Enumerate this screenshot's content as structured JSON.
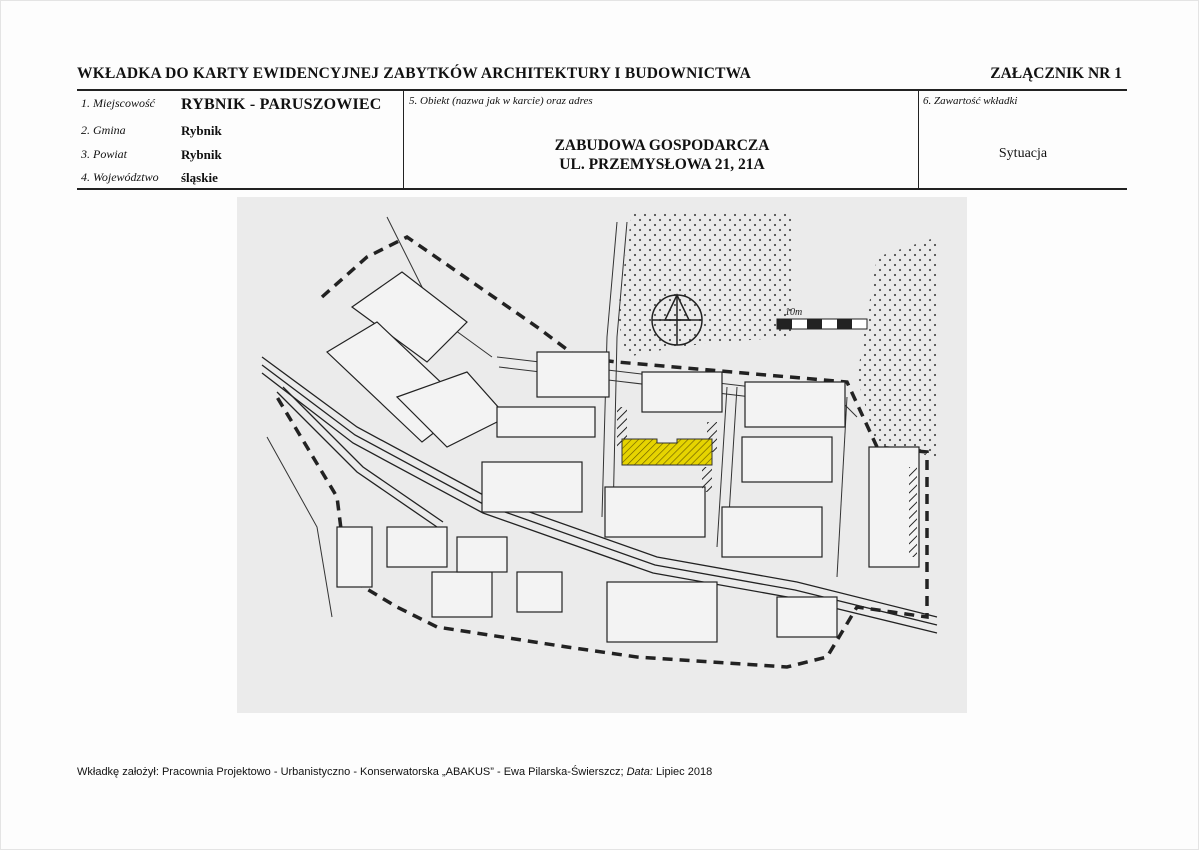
{
  "header": {
    "title": "WKŁADKA DO KARTY EWIDENCYJNEJ ZABYTKÓW ARCHITEKTURY I BUDOWNICTWA",
    "annex": "ZAŁĄCZNIK NR 1"
  },
  "fields": {
    "locality_label": "1. Miejscowość",
    "locality_value": "RYBNIK - PARUSZOWIEC",
    "commune_label": "2. Gmina",
    "commune_value": "Rybnik",
    "county_label": "3. Powiat",
    "county_value": "Rybnik",
    "voivodeship_label": "4. Województwo",
    "voivodeship_value": "śląskie",
    "object_label": "5. Obiekt (nazwa jak w karcie) oraz adres",
    "object_line1": "ZABUDOWA GOSPODARCZA",
    "object_line2": "UL. PRZEMYSŁOWA 21, 21A",
    "content_label": "6. Zawartość wkładki",
    "content_value": "Sytuacja"
  },
  "map": {
    "scale_label": "10m",
    "highlight_color": "#e6d400"
  },
  "footer": {
    "prefix": "Wkładkę założył: Pracownia Projektowo - Urbanistyczno - Konserwatorska „ABAKUS” - Ewa Pilarska-Świerszcz;",
    "date_label": "Data:",
    "date_value": "Lipiec 2018"
  }
}
